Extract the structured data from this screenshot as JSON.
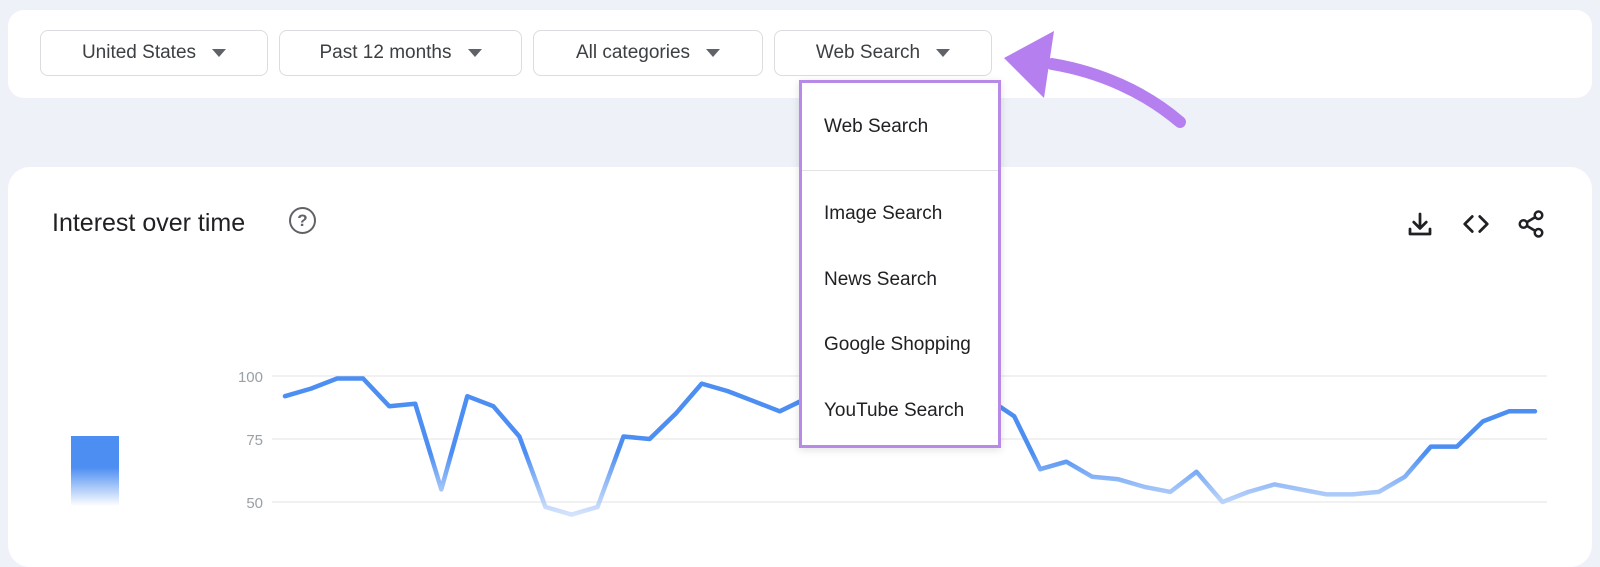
{
  "filters": [
    {
      "label": "United States"
    },
    {
      "label": "Past 12 months"
    },
    {
      "label": "All categories"
    },
    {
      "label": "Web Search"
    }
  ],
  "dropdown": {
    "items": [
      {
        "label": "Web Search"
      },
      {
        "label": "Image Search"
      },
      {
        "label": "News Search"
      },
      {
        "label": "Google Shopping"
      },
      {
        "label": "YouTube Search"
      }
    ]
  },
  "card": {
    "title": "Interest over time",
    "help_icon": "help-circle-icon",
    "actions": [
      "download-icon",
      "embed-code-icon",
      "share-icon"
    ]
  },
  "chart_data": {
    "type": "line",
    "y_ticks": [
      "100",
      "75",
      "50"
    ],
    "ylim": [
      50,
      100
    ],
    "grid": true,
    "series": [
      {
        "color": "#4d8ef2",
        "values": [
          92,
          95,
          99,
          99,
          88,
          89,
          55,
          92,
          88,
          76,
          48,
          45,
          48,
          76,
          75,
          85,
          97,
          94,
          90,
          86,
          91,
          88,
          87,
          85,
          90,
          92,
          93,
          91,
          84,
          63,
          66,
          60,
          59,
          56,
          54,
          62,
          50,
          54,
          57,
          55,
          53,
          53,
          54,
          60,
          72,
          72,
          82,
          86,
          86
        ]
      }
    ]
  },
  "colors": {
    "accent_line": "#4d8ef2",
    "highlight": "#b68ae6",
    "arrow": "#b57ff0"
  }
}
